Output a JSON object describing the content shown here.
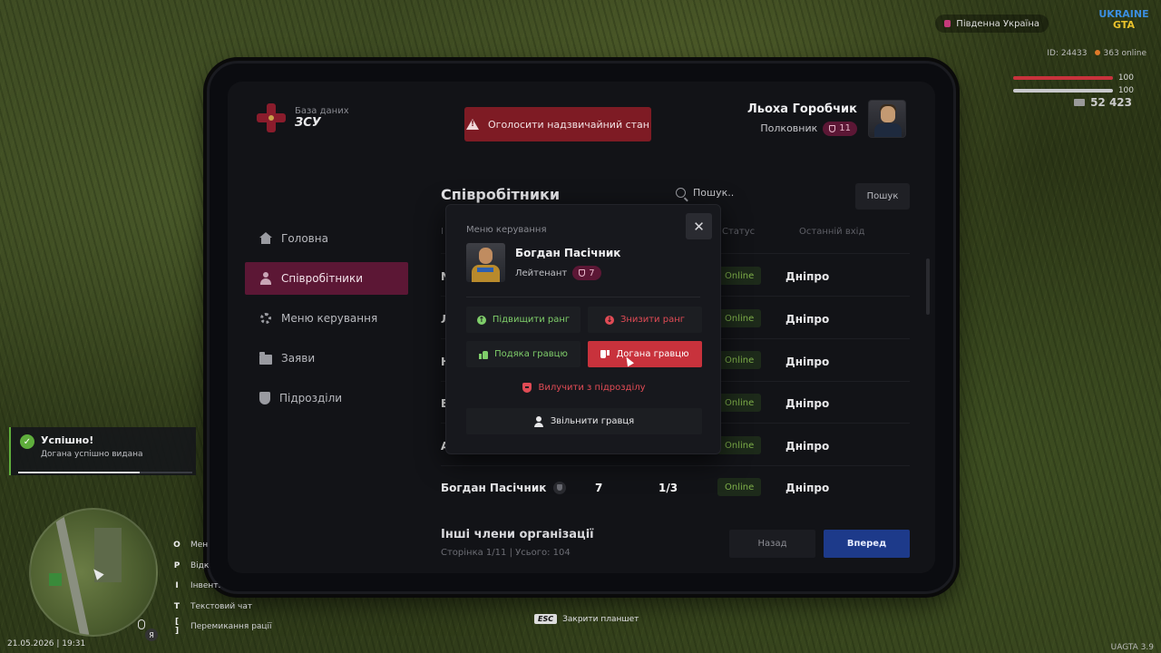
{
  "hud": {
    "region": "Південна Україна",
    "logo_line1": "UKRAINE",
    "logo_line2": "GTA",
    "player_id": "ID: 24433",
    "online": "363 online",
    "health_value": "100",
    "armor_value": "100",
    "health_percent": 100,
    "armor_percent": 100,
    "money": "52 423",
    "colors": {
      "health": "#c8323c",
      "armor": "#c8c8cc"
    }
  },
  "tablet": {
    "brand_sub": "База даних",
    "brand_title": "ЗСУ",
    "emergency_label": "Оголосити надзвичайний стан",
    "user_name": "Льоха Горобчик",
    "user_rank": "Полковник",
    "user_rank_level": "11",
    "sidebar": [
      {
        "label": "Головна",
        "icon": "home-icon"
      },
      {
        "label": "Співробітники",
        "icon": "users-icon",
        "active": true
      },
      {
        "label": "Меню керування",
        "icon": "gear-icon"
      },
      {
        "label": "Заяви",
        "icon": "folder-icon"
      },
      {
        "label": "Підрозділи",
        "icon": "shield-icon"
      }
    ],
    "content_title": "Співробітники",
    "search_placeholder": "Пошук..",
    "search_button": "Пошук",
    "headers": {
      "col1": "І",
      "status": "Статус",
      "last_login": "Останній вхід"
    },
    "rows": [
      {
        "name_initial": "N",
        "status": "Online",
        "city": "Дніпро"
      },
      {
        "name_initial": "Л",
        "status": "Online",
        "city": "Дніпро"
      },
      {
        "name_initial": "Н",
        "status": "Online",
        "city": "Дніпро"
      },
      {
        "name_initial": "В",
        "status": "Online",
        "city": "Дніпро"
      },
      {
        "name_initial": "А",
        "status": "Online",
        "city": "Дніпро"
      },
      {
        "name": "Богдан Пасічник",
        "rank": "7",
        "warnings": "1/3",
        "status": "Online",
        "city": "Дніпро"
      }
    ],
    "others_title": "Інші члени організації",
    "pagination": "Сторінка 1/11 | Усього: 104",
    "back_button": "Назад",
    "next_button": "Вперед",
    "colors": {
      "accent": "#5c1735",
      "online": "#7fb04a",
      "primary_button": "#1d3a8a"
    }
  },
  "modal": {
    "label": "Меню керування",
    "close_icon": "close-icon",
    "name": "Богдан Пасічник",
    "rank": "Лейтенант",
    "rank_level": "7",
    "promote": "Підвищити ранг",
    "demote": "Знизити ранг",
    "thanks": "Подяка гравцю",
    "reprimand": "Догана гравцю",
    "remove_from_unit": "Вилучити з підрозділу",
    "fire": "Звільнити гравця",
    "colors": {
      "positive": "#7fce6a",
      "negative": "#e04b55",
      "danger": "#c8323c"
    }
  },
  "notification": {
    "title": "Успішно!",
    "text": "Догана успішно видана",
    "progress": 0.7
  },
  "hotkeys": [
    {
      "key": "O",
      "label": "Мен"
    },
    {
      "key": "P",
      "label": "Відк"
    },
    {
      "key": "I",
      "label": "Інвент."
    },
    {
      "key": "T",
      "label": "Текстовий чат"
    },
    {
      "key": "[ ]",
      "label": "Перемикання рації"
    }
  ],
  "minimap_badge": "Я",
  "datetime": "21.05.2026 | 19:31",
  "esc_key": "ESC",
  "esc_hint": "Закрити планшет",
  "version": "UAGTA 3.9"
}
